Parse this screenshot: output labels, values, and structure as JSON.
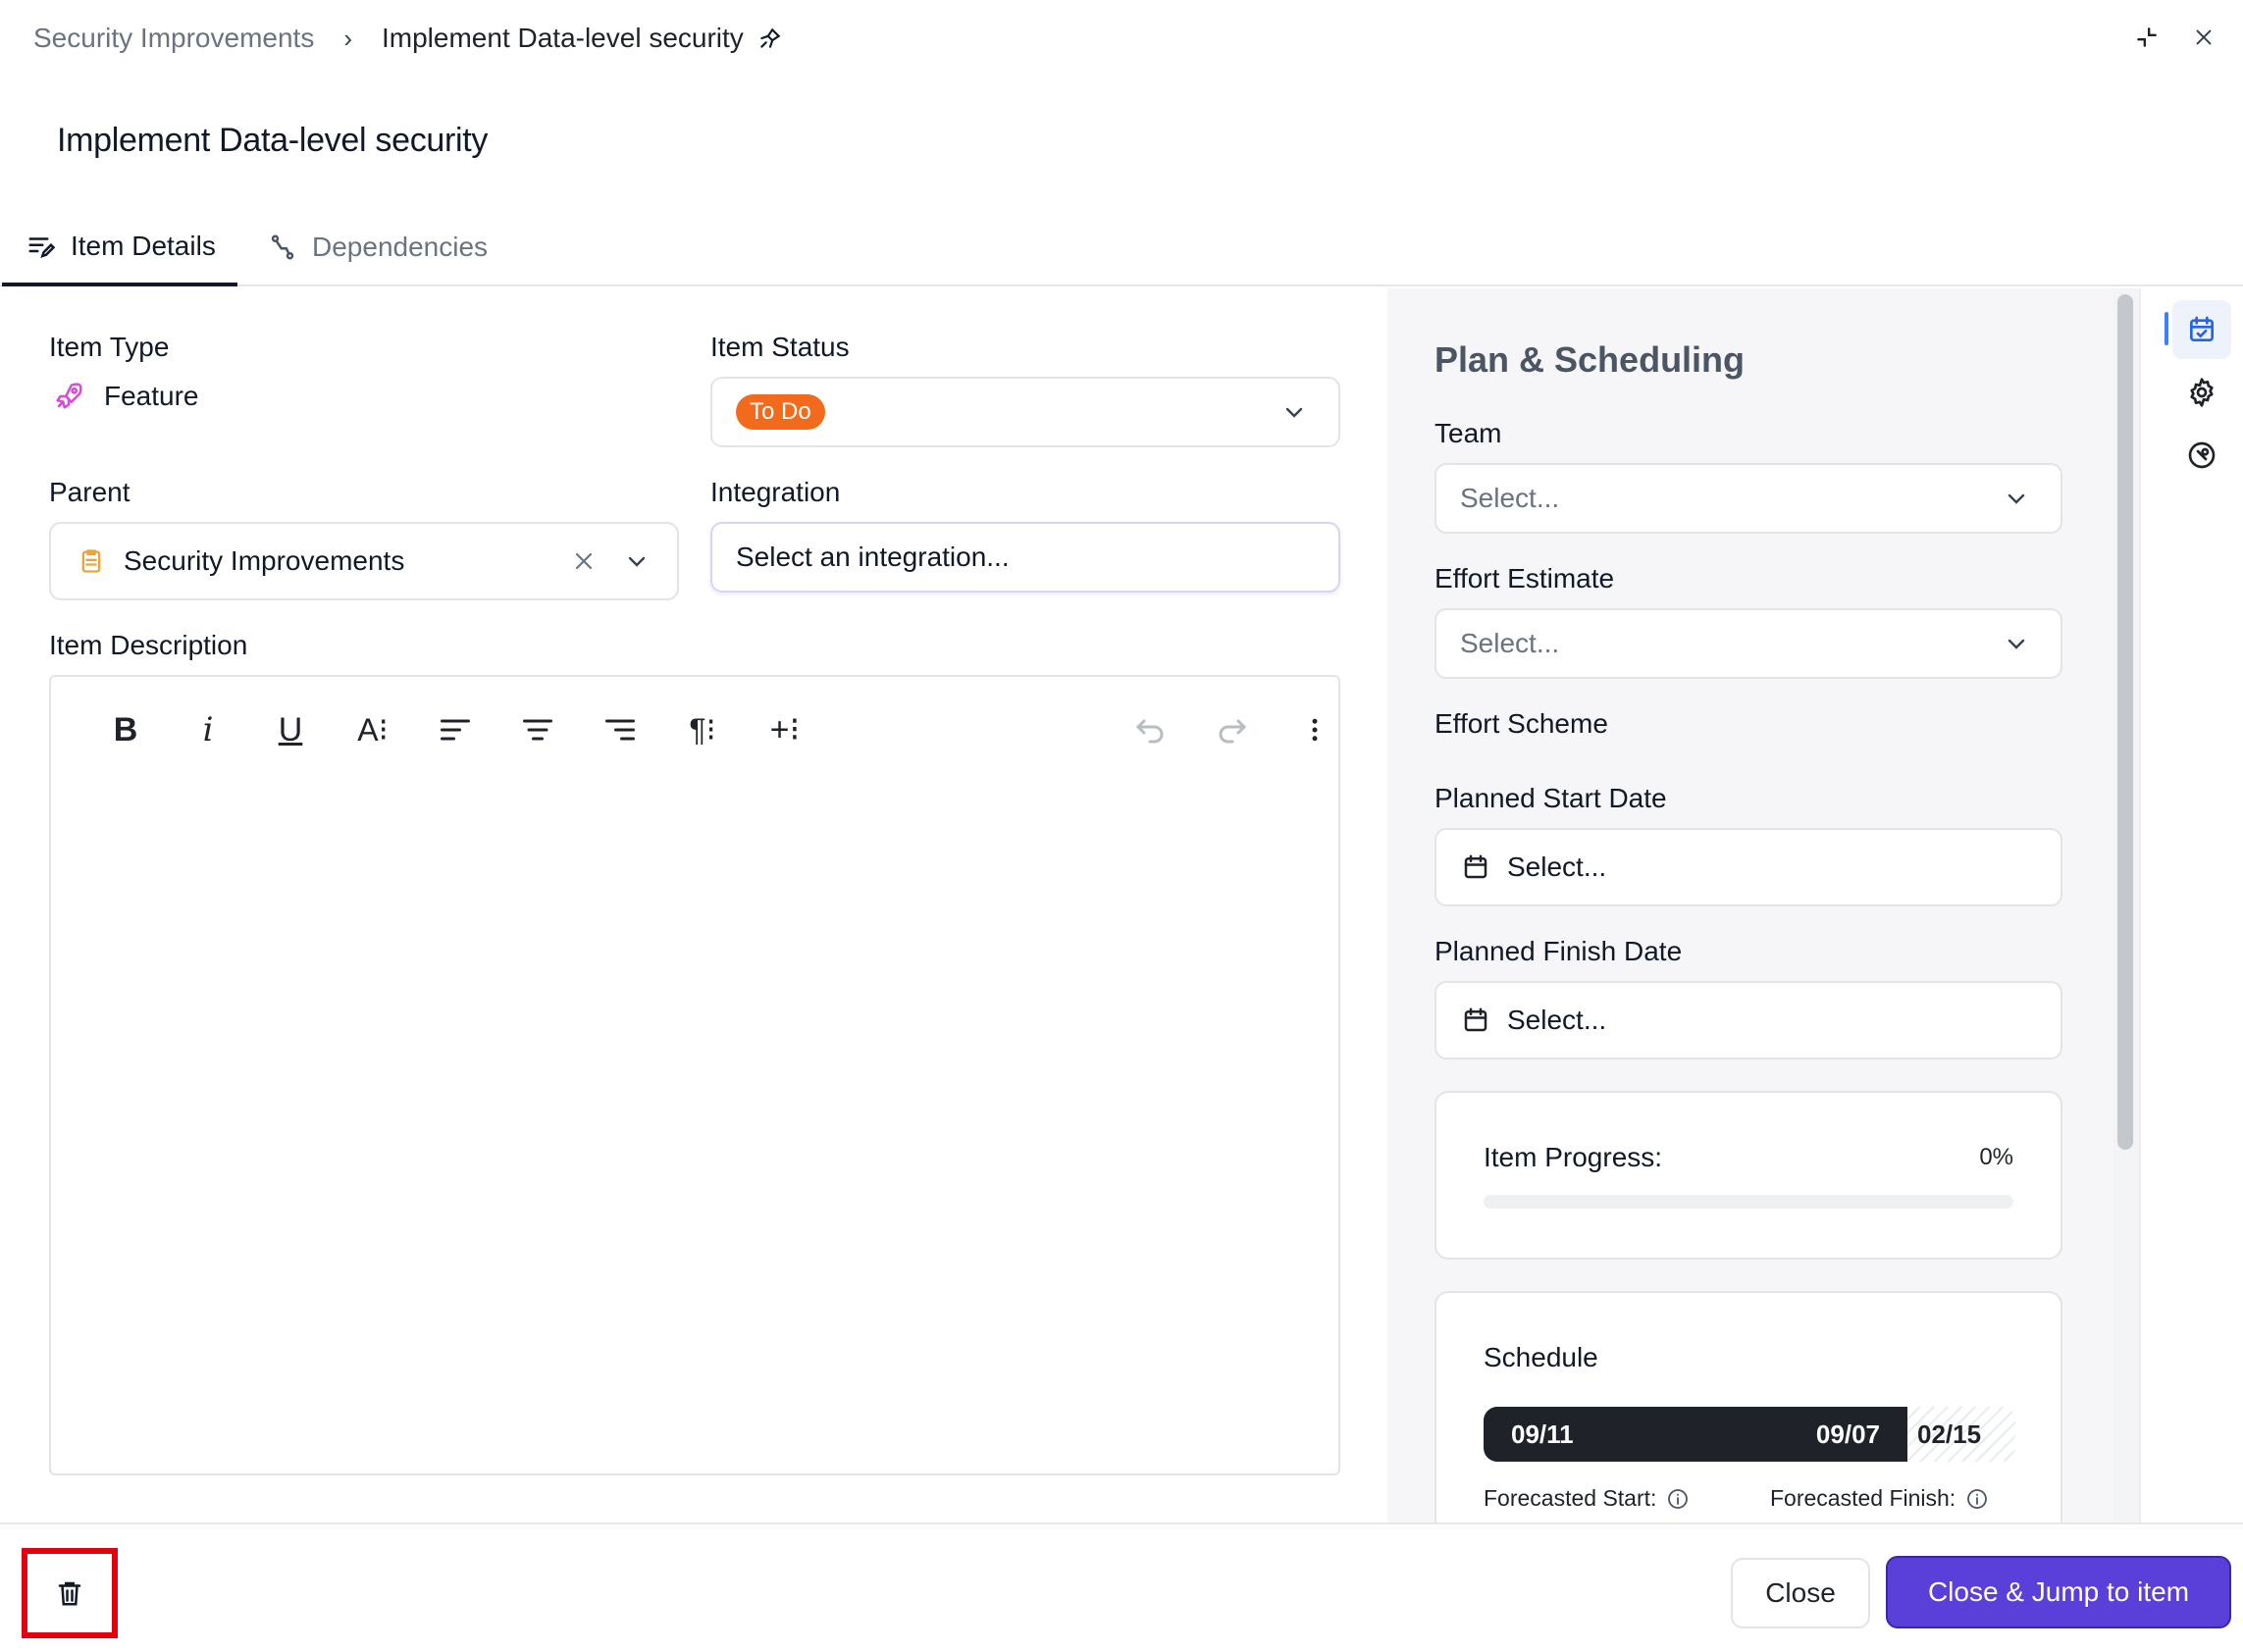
{
  "breadcrumb": {
    "parent": "Security Improvements",
    "separator": "›",
    "current": "Implement Data-level security",
    "current_icon": "feature-rocket-icon"
  },
  "header": {
    "collapse_icon": "minimize-icon",
    "close_icon": "close-icon"
  },
  "title": "Implement Data-level security",
  "tabs": [
    {
      "label": "Item Details",
      "icon": "edit-lines-icon",
      "active": true
    },
    {
      "label": "Dependencies",
      "icon": "route-icon",
      "active": false
    }
  ],
  "details": {
    "item_type_label": "Item Type",
    "item_type_value": "Feature",
    "item_status_label": "Item Status",
    "item_status_value": "To Do",
    "item_status_color": "#f26b1d",
    "parent_label": "Parent",
    "parent_value": "Security Improvements",
    "integration_label": "Integration",
    "integration_placeholder": "Select an integration...",
    "description_label": "Item Description"
  },
  "editor_toolbar": {
    "bold": "B",
    "italic": "i",
    "underline": "U",
    "font": "A⁝",
    "paragraph": "¶⁝",
    "insert": "+⁝"
  },
  "plan": {
    "title": "Plan & Scheduling",
    "team_label": "Team",
    "team_placeholder": "Select...",
    "effort_label": "Effort Estimate",
    "effort_placeholder": "Select...",
    "scheme_label": "Effort Scheme",
    "start_label": "Planned Start Date",
    "start_placeholder": "Select...",
    "finish_label": "Planned Finish Date",
    "finish_placeholder": "Select...",
    "progress_label": "Item Progress:",
    "progress_value": "0%",
    "progress_fraction": 0,
    "schedule_title": "Schedule",
    "schedule_start": "09/11",
    "schedule_end": "09/07",
    "schedule_forecast": "02/15",
    "forecasted_start_label": "Forecasted Start:",
    "forecasted_finish_label": "Forecasted Finish:"
  },
  "rail": [
    "calendar-check-icon",
    "gear-icon",
    "wrench-circle-icon"
  ],
  "footer": {
    "close_label": "Close",
    "jump_label": "Close & Jump to item",
    "accent": "#5b3fd9",
    "delete_icon": "trash-icon"
  }
}
